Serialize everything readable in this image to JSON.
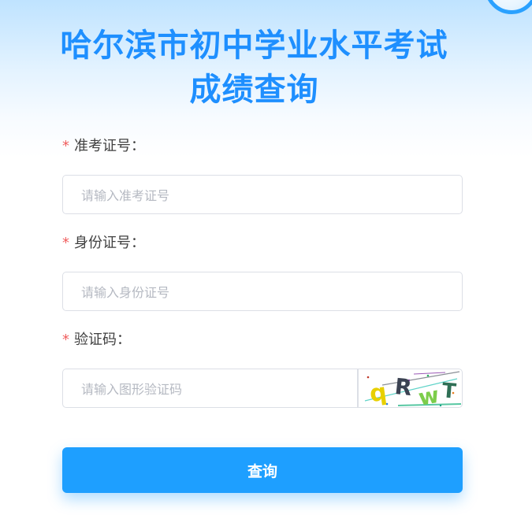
{
  "page": {
    "title_line1": "哈尔滨市初中学业水平考试",
    "title_line2": "成绩查询"
  },
  "form": {
    "required_mark": "*",
    "exam_number": {
      "label": "准考证号：",
      "placeholder": "请输入准考证号"
    },
    "id_number": {
      "label": "身份证号：",
      "placeholder": "请输入身份证号"
    },
    "captcha": {
      "label": "验证码：",
      "placeholder": "请输入图形验证码",
      "image_text": [
        "q",
        "R",
        "w",
        "T"
      ]
    },
    "submit_label": "查询"
  },
  "colors": {
    "accent": "#1e9fff",
    "title": "#1e8fff",
    "required": "#f05d5d"
  }
}
